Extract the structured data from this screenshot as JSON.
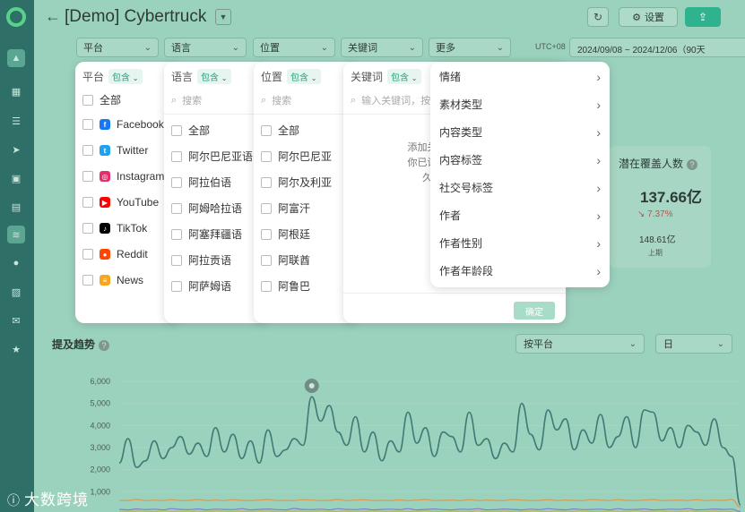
{
  "header": {
    "back_icon": "arrow-left-icon",
    "title": "[Demo] Cybertruck",
    "settings_label": "设置"
  },
  "filters": {
    "platform": "平台",
    "language": "语言",
    "location": "位置",
    "keyword": "关键词",
    "more": "更多",
    "timezone": "UTC+08",
    "date_range": "2024/09/08 ~ 2024/12/06（90天"
  },
  "panels": {
    "platform": {
      "title": "平台",
      "include_label": "包含",
      "items": [
        {
          "label": "全部"
        },
        {
          "label": "Facebook",
          "icon": "facebook-icon",
          "color": "#1877f2"
        },
        {
          "label": "Twitter",
          "icon": "twitter-icon",
          "color": "#1da1f2"
        },
        {
          "label": "Instagram",
          "icon": "instagram-icon",
          "color": "#e1306c"
        },
        {
          "label": "YouTube",
          "icon": "youtube-icon",
          "color": "#ff0000"
        },
        {
          "label": "TikTok",
          "icon": "tiktok-icon",
          "color": "#000000"
        },
        {
          "label": "Reddit",
          "icon": "reddit-icon",
          "color": "#ff4500"
        },
        {
          "label": "News",
          "icon": "news-icon",
          "color": "#f5a623"
        }
      ]
    },
    "language": {
      "title": "语言",
      "include_label": "包含",
      "search_placeholder": "搜索",
      "items": [
        "全部",
        "阿尔巴尼亚语",
        "阿拉伯语",
        "阿姆哈拉语",
        "阿塞拜疆语",
        "阿拉贡语",
        "阿萨姆语"
      ]
    },
    "location": {
      "title": "位置",
      "include_label": "包含",
      "search_placeholder": "搜索",
      "items": [
        "全部",
        "阿尔巴尼亚",
        "阿尔及利亚",
        "阿富汗",
        "阿根廷",
        "阿联酋",
        "阿鲁巴"
      ]
    },
    "keyword": {
      "title": "关键词",
      "include_label": "包含",
      "input_placeholder": "输入关键词，按",
      "empty_line1": "添加关键词进行",
      "empty_line2": "你已设置的查询",
      "empty_line3": "久优化。",
      "ok_label": "确定"
    },
    "more": {
      "items": [
        "情绪",
        "素材类型",
        "内容类型",
        "内容标签",
        "社交号标签",
        "作者",
        "作者性别",
        "作者年龄段"
      ]
    }
  },
  "stat": {
    "label": "潜在覆盖人数",
    "value": "137.66亿",
    "change": "↘ 7.37%",
    "previous": "148.61亿",
    "previous_label": "上期"
  },
  "trend": {
    "title": "提及趋势",
    "group_by": "按平台",
    "interval": "日"
  },
  "chart_data": {
    "type": "line",
    "yticks": [
      "6,000",
      "5,000",
      "4,000",
      "3,000",
      "2,000",
      "1,000"
    ],
    "ylim": [
      0,
      6000
    ],
    "series": [
      {
        "color": "#3f7b76",
        "values": [
          2300,
          3400,
          2100,
          2400,
          3300,
          2500,
          3000,
          3500,
          2700,
          3200,
          2600,
          3900,
          2800,
          3600,
          2500,
          3300,
          2300,
          3800,
          2600,
          2900,
          3400,
          3100,
          5300,
          4200,
          4900,
          3700,
          3100,
          4400,
          2800,
          3700,
          2400,
          3300,
          2800,
          4600,
          3200,
          3900,
          2600,
          3700,
          3500,
          2800,
          4600,
          3100,
          3400,
          2500,
          3200,
          2800,
          5000,
          3600,
          2900,
          4700,
          3800,
          4300,
          2900,
          3800,
          3200,
          4500,
          3000,
          3500,
          4400,
          3000,
          4700,
          4600,
          3300,
          3900,
          3000,
          4000,
          3700,
          3100,
          4300,
          3000,
          2600,
          400
        ]
      },
      {
        "color": "#d99a4e",
        "values": [
          600,
          600,
          650,
          600,
          620,
          600,
          640,
          600,
          610,
          650,
          600,
          620,
          600,
          640,
          610,
          600,
          620,
          650,
          600,
          610,
          600,
          640,
          620,
          600,
          610,
          650,
          600,
          620,
          640,
          600,
          610,
          600,
          630,
          600,
          620,
          650,
          600,
          610,
          620,
          600,
          640,
          600,
          620,
          610,
          600,
          650,
          620,
          600,
          610,
          640,
          600,
          620,
          610,
          600,
          650,
          620,
          600,
          640,
          610,
          600,
          620,
          650,
          600,
          610,
          620,
          600,
          640,
          600,
          620,
          610,
          650,
          300
        ]
      },
      {
        "color": "#7c83c9",
        "values": [
          200,
          180,
          220,
          190,
          210,
          180,
          230,
          200,
          190,
          220,
          180,
          210,
          200,
          190,
          230,
          180,
          200,
          220,
          190,
          180,
          240,
          200,
          190,
          210,
          180,
          230,
          200,
          190,
          220,
          180,
          200,
          210,
          190,
          230,
          180,
          200,
          220,
          190,
          180,
          210,
          200,
          230,
          180,
          190,
          220,
          200,
          180,
          210,
          190,
          230,
          200,
          180,
          220,
          190,
          200,
          210,
          180,
          230,
          190,
          200,
          220,
          180,
          190,
          210,
          200,
          230,
          180,
          190,
          220,
          200,
          210,
          100
        ]
      },
      {
        "color": "#c7b64e",
        "values": [
          100,
          100,
          120,
          110,
          100,
          130,
          100,
          110,
          120,
          100,
          100,
          130,
          110,
          100,
          120,
          100,
          110,
          130,
          100,
          100,
          120,
          110,
          100,
          130,
          100,
          110,
          120,
          100,
          100,
          130,
          110,
          100,
          120,
          100,
          110,
          130,
          100,
          100,
          120,
          110,
          100,
          130,
          100,
          110,
          120,
          100,
          100,
          130,
          110,
          100,
          120,
          100,
          110,
          130,
          100,
          100,
          120,
          110,
          100,
          130,
          100,
          110,
          120,
          100,
          100,
          130,
          110,
          100,
          120,
          100,
          110,
          50
        ]
      }
    ]
  },
  "watermark": "大数跨境"
}
